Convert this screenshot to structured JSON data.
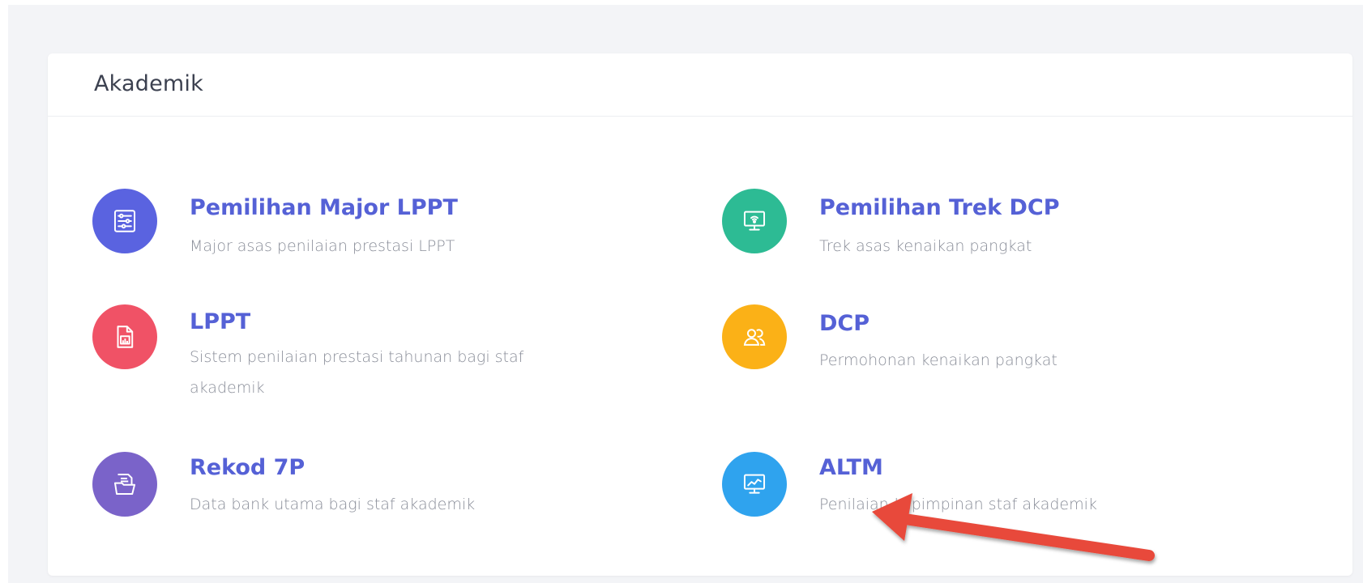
{
  "section": {
    "title": "Akademik"
  },
  "items": [
    {
      "title": "Pemilihan Major LPPT",
      "description": "Major asas penilaian prestasi LPPT",
      "icon": "settings-sliders-icon",
      "color": "#5a63e0"
    },
    {
      "title": "Pemilihan Trek DCP",
      "description": "Trek asas kenaikan pangkat",
      "icon": "monitor-signal-icon",
      "color": "#2dbb94"
    },
    {
      "title": "LPPT",
      "description": "Sistem penilaian prestasi tahunan bagi staf akademik",
      "icon": "document-chart-icon",
      "color": "#f05266"
    },
    {
      "title": "DCP",
      "description": "Permohonan kenaikan pangkat",
      "icon": "users-icon",
      "color": "#fbb117"
    },
    {
      "title": "Rekod 7P",
      "description": "Data bank utama bagi staf akademik",
      "icon": "folder-document-icon",
      "color": "#7a63c9"
    },
    {
      "title": "ALTM",
      "description": "Penilaian kepimpinan staf akademik",
      "icon": "monitor-chart-icon",
      "color": "#2fa3ee"
    }
  ],
  "annotation": {
    "arrow_color": "#e8493a"
  }
}
